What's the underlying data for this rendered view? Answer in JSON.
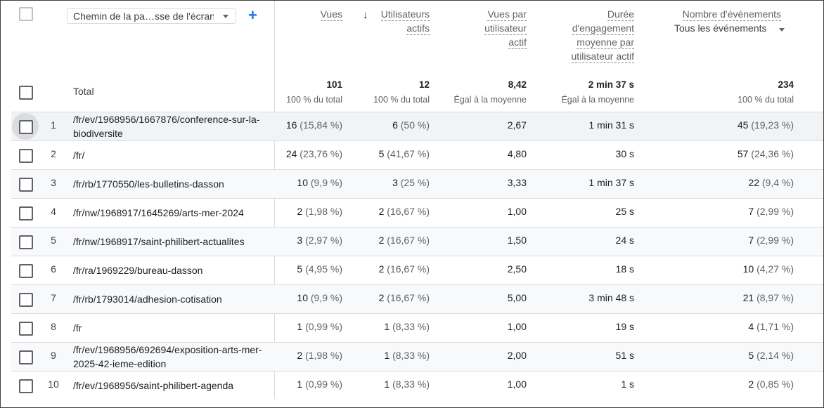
{
  "header": {
    "dimension_label": "Chemin de la pa…sse de l'écran",
    "add_label": "+",
    "metrics": [
      {
        "lines": [
          "Vues"
        ]
      },
      {
        "lines": [
          "Utilisateurs",
          "actifs"
        ],
        "sorted": true
      },
      {
        "lines": [
          "Vues par",
          "utilisateur",
          "actif"
        ]
      },
      {
        "lines": [
          "Durée",
          "d'engagement",
          "moyenne par",
          "utilisateur actif"
        ]
      },
      {
        "lines": [
          "Nombre d'événements"
        ]
      }
    ],
    "events_select": "Tous les événements",
    "sort_arrow": "↓"
  },
  "totals": {
    "label": "Total",
    "values": [
      {
        "value": "101",
        "sub": "100 % du total"
      },
      {
        "value": "12",
        "sub": "100 % du total"
      },
      {
        "value": "8,42",
        "sub": "Égal à la moyenne"
      },
      {
        "value": "2 min 37 s",
        "sub": "Égal à la moyenne"
      },
      {
        "value": "234",
        "sub": "100 % du total"
      }
    ]
  },
  "rows": [
    {
      "n": "1",
      "path": "/fr/ev/1968956/1667876/conference-sur-la-biodiversite",
      "views": "16",
      "views_pct": "(15,84 %)",
      "users": "6",
      "users_pct": "(50 %)",
      "vpu": "2,67",
      "dur": "1 min 31 s",
      "events": "45",
      "events_pct": "(19,23 %)"
    },
    {
      "n": "2",
      "path": "/fr/",
      "views": "24",
      "views_pct": "(23,76 %)",
      "users": "5",
      "users_pct": "(41,67 %)",
      "vpu": "4,80",
      "dur": "30 s",
      "events": "57",
      "events_pct": "(24,36 %)"
    },
    {
      "n": "3",
      "path": "/fr/rb/1770550/les-bulletins-dasson",
      "views": "10",
      "views_pct": "(9,9 %)",
      "users": "3",
      "users_pct": "(25 %)",
      "vpu": "3,33",
      "dur": "1 min 37 s",
      "events": "22",
      "events_pct": "(9,4 %)"
    },
    {
      "n": "4",
      "path": "/fr/nw/1968917/1645269/arts-mer-2024",
      "views": "2",
      "views_pct": "(1,98 %)",
      "users": "2",
      "users_pct": "(16,67 %)",
      "vpu": "1,00",
      "dur": "25 s",
      "events": "7",
      "events_pct": "(2,99 %)"
    },
    {
      "n": "5",
      "path": "/fr/nw/1968917/saint-philibert-actualites",
      "views": "3",
      "views_pct": "(2,97 %)",
      "users": "2",
      "users_pct": "(16,67 %)",
      "vpu": "1,50",
      "dur": "24 s",
      "events": "7",
      "events_pct": "(2,99 %)"
    },
    {
      "n": "6",
      "path": "/fr/ra/1969229/bureau-dasson",
      "views": "5",
      "views_pct": "(4,95 %)",
      "users": "2",
      "users_pct": "(16,67 %)",
      "vpu": "2,50",
      "dur": "18 s",
      "events": "10",
      "events_pct": "(4,27 %)"
    },
    {
      "n": "7",
      "path": "/fr/rb/1793014/adhesion-cotisation",
      "views": "10",
      "views_pct": "(9,9 %)",
      "users": "2",
      "users_pct": "(16,67 %)",
      "vpu": "5,00",
      "dur": "3 min 48 s",
      "events": "21",
      "events_pct": "(8,97 %)"
    },
    {
      "n": "8",
      "path": "/fr",
      "views": "1",
      "views_pct": "(0,99 %)",
      "users": "1",
      "users_pct": "(8,33 %)",
      "vpu": "1,00",
      "dur": "19 s",
      "events": "4",
      "events_pct": "(1,71 %)"
    },
    {
      "n": "9",
      "path": "/fr/ev/1968956/692694/exposition-arts-mer-2025-42-ieme-edition",
      "views": "2",
      "views_pct": "(1,98 %)",
      "users": "1",
      "users_pct": "(8,33 %)",
      "vpu": "2,00",
      "dur": "51 s",
      "events": "5",
      "events_pct": "(2,14 %)"
    },
    {
      "n": "10",
      "path": "/fr/ev/1968956/saint-philibert-agenda",
      "views": "1",
      "views_pct": "(0,99 %)",
      "users": "1",
      "users_pct": "(8,33 %)",
      "vpu": "1,00",
      "dur": "1 s",
      "events": "2",
      "events_pct": "(0,85 %)"
    }
  ]
}
